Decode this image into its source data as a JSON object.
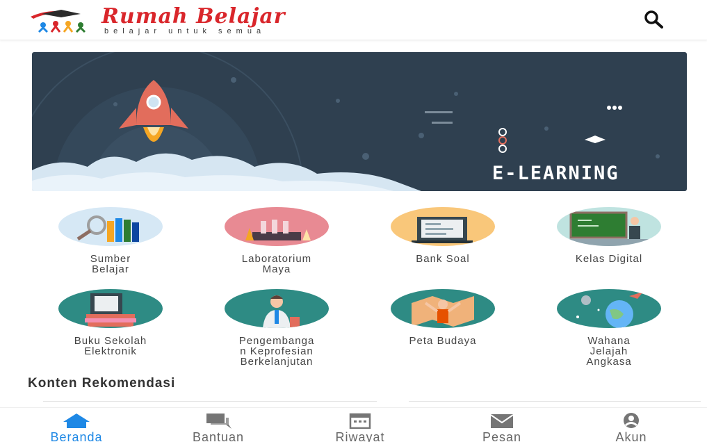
{
  "header": {
    "logo_title": "Rumah Belajar",
    "logo_tagline": "belajar untuk semua",
    "search_icon": "search-icon"
  },
  "banner": {
    "title": "E-LEARNING"
  },
  "menu": {
    "items": [
      {
        "label": "Sumber\nBelajar",
        "icon": "books-magnifier-icon"
      },
      {
        "label": "Laboratorium\nMaya",
        "icon": "lab-flasks-icon"
      },
      {
        "label": "Bank Soal",
        "icon": "question-sheet-icon"
      },
      {
        "label": "Kelas Digital",
        "icon": "digital-classroom-icon"
      },
      {
        "label": "Buku Sekolah\nElektronik",
        "icon": "ebook-icon"
      },
      {
        "label": "Pengembanga\nn Keprofesian\nBerkelanjutan",
        "icon": "teacher-icon"
      },
      {
        "label": "Peta Budaya",
        "icon": "culture-map-icon"
      },
      {
        "label": "Wahana\nJelajah\nAngkasa",
        "icon": "space-planet-icon"
      }
    ]
  },
  "recommendation": {
    "title": "Konten Rekomendasi"
  },
  "bottom_nav": {
    "items": [
      {
        "label": "Beranda",
        "icon": "home-icon",
        "active": true
      },
      {
        "label": "Bantuan",
        "icon": "chat-icon",
        "active": false
      },
      {
        "label": "Riwayat",
        "icon": "calendar-icon",
        "active": false
      },
      {
        "label": "Pesan",
        "icon": "mail-icon",
        "active": false
      },
      {
        "label": "Akun",
        "icon": "account-icon",
        "active": false
      }
    ]
  },
  "colors": {
    "brand_red": "#d9262b",
    "banner_bg": "#2f4050",
    "active_blue": "#1e88e5"
  }
}
